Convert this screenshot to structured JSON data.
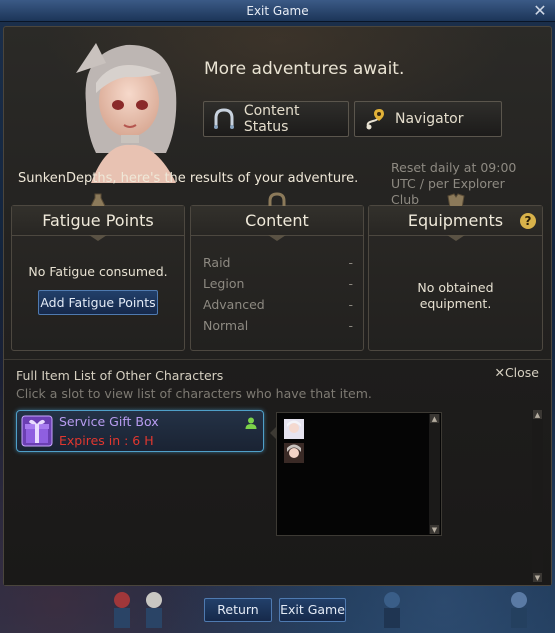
{
  "window": {
    "title": "Exit Game",
    "close_glyph": "✕"
  },
  "header": {
    "headline": "More adventures await.",
    "buttons": [
      {
        "label": "Content Status",
        "icon": "horseshoe-icon"
      },
      {
        "label": "Navigator",
        "icon": "route-pin-icon"
      }
    ]
  },
  "results": {
    "message": "SunkenDepths, here's the results of your adventure.",
    "reset_note_line1": "Reset daily at 09:00",
    "reset_note_line2": "UTC / per Explorer Club"
  },
  "panels": {
    "fatigue": {
      "title": "Fatigue Points",
      "message": "No Fatigue consumed.",
      "button": "Add Fatigue Points"
    },
    "content": {
      "title": "Content",
      "rows": [
        {
          "label": "Raid",
          "value": "-"
        },
        {
          "label": "Legion",
          "value": "-"
        },
        {
          "label": "Advanced",
          "value": "-"
        },
        {
          "label": "Normal",
          "value": "-"
        }
      ]
    },
    "equipments": {
      "title": "Equipments",
      "message_line1": "No obtained",
      "message_line2": "equipment.",
      "help_glyph": "?"
    }
  },
  "item_list": {
    "title": "Full Item List of Other Characters",
    "subtitle": "Click a slot to view list of characters who have that item.",
    "close_label": "✕Close",
    "slot": {
      "name": "Service Gift Box",
      "expires": "Expires in : 6 H"
    }
  },
  "footer": {
    "return_label": "Return",
    "exit_label": "Exit Game"
  },
  "colors": {
    "accent_blue": "#4f7ab0",
    "expire_red": "#e0372f",
    "item_purple": "#b89cf0"
  }
}
